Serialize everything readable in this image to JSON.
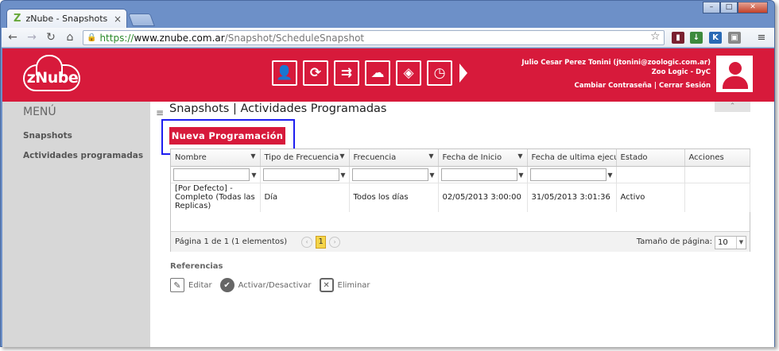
{
  "browser": {
    "tab_title": "zNube - Snapshots",
    "tab_logo": "Z",
    "url_scheme": "https://",
    "url_host": "www.znube.com.ar",
    "url_path": "/Snapshot/ScheduleSnapshot",
    "window_buttons": [
      "–",
      "□",
      "✕"
    ]
  },
  "header": {
    "logo_text": "zNube",
    "icons": [
      "user-settings-icon",
      "sync-icon",
      "transfer-icon",
      "cloud-settings-icon",
      "box-icon",
      "clock-icon",
      "next-arrow-icon"
    ],
    "user_line": "Julio Cesar Perez Tonini (jtonini@zoologic.com.ar)",
    "company": "Zoo Logic - DyC",
    "change_password": "Cambiar Contraseña",
    "separator": "|",
    "logout": "Cerrar Sesión"
  },
  "sidebar": {
    "title": "MENÚ",
    "items": [
      "Snapshots",
      "Actividades programadas"
    ]
  },
  "page": {
    "title": "Snapshots | Actividades Programadas",
    "new_button": "Nueva Programación"
  },
  "grid": {
    "columns": [
      "Nombre",
      "Tipo de Frecuencia",
      "Frecuencia",
      "Fecha de Inicio",
      "Fecha de ultima ejecución",
      "Estado",
      "Acciones"
    ],
    "rows": [
      [
        "[Por Defecto] - Completo (Todas las Replicas)",
        "Día",
        "Todos los días",
        "02/05/2013 3:00:00",
        "31/05/2013 3:01:36",
        "Activo",
        ""
      ]
    ],
    "pager_text": "Página 1 de 1 (1 elementos)",
    "current_page": "1",
    "page_size_label": "Tamaño de página:",
    "page_size_value": "10"
  },
  "references": {
    "title": "Referencias",
    "items": [
      {
        "icon": "edit-icon",
        "label": "Editar"
      },
      {
        "icon": "toggle-check-icon",
        "label": "Activar/Desactivar"
      },
      {
        "icon": "delete-icon",
        "label": "Eliminar"
      }
    ]
  }
}
